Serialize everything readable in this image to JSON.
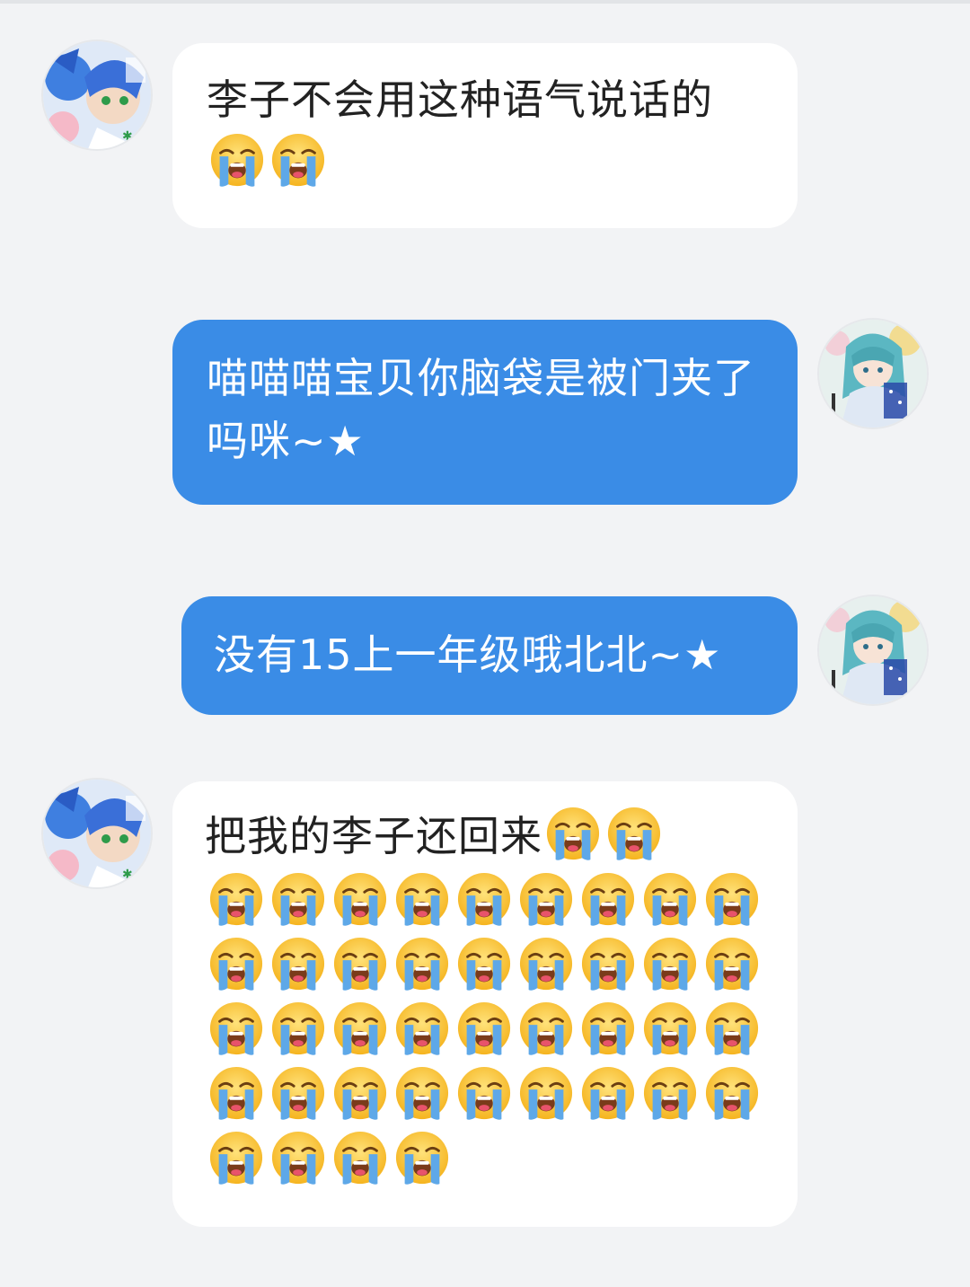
{
  "colors": {
    "background": "#f2f3f5",
    "incoming_bubble": "#ffffff",
    "outgoing_bubble": "#3a8ce6",
    "incoming_text": "#222222",
    "outgoing_text": "#ffffff"
  },
  "messages": [
    {
      "side": "incoming",
      "text": "李子不会用这种语气说话的",
      "emoji": "loudly-crying-face",
      "emoji_count": 2
    },
    {
      "side": "outgoing",
      "text": "喵喵喵宝贝你脑袋是被门夹了吗咪~★"
    },
    {
      "side": "outgoing",
      "text": "没有15上一年级哦北北~★"
    },
    {
      "side": "incoming",
      "text": "把我的李子还回来",
      "emoji": "loudly-crying-face",
      "emoji_count": 42
    }
  ]
}
